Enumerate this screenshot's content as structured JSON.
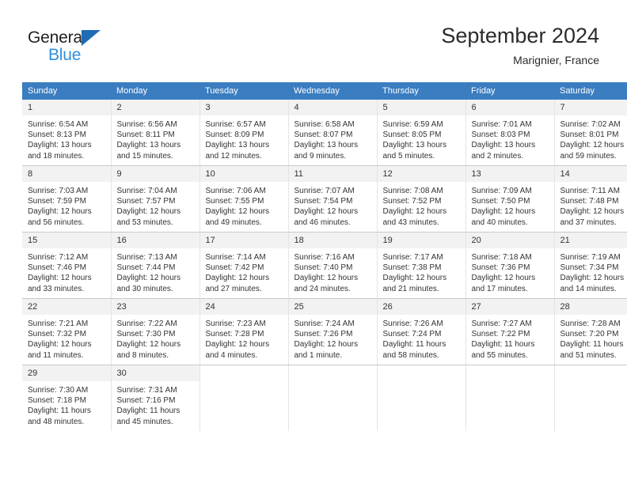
{
  "brand": {
    "line1": "General",
    "line2": "Blue",
    "triangle_color": "#1f6bb5",
    "line2_color": "#2f8fdd"
  },
  "header": {
    "title": "September 2024",
    "subtitle": "Marignier, France"
  },
  "theme": {
    "header_row_bg": "#3a7dc0",
    "header_row_text": "#ffffff",
    "daynum_bg": "#f2f2f2",
    "cell_text": "#333333",
    "grid_line": "#c8c8c8"
  },
  "calendar": {
    "weekday_headers": [
      "Sunday",
      "Monday",
      "Tuesday",
      "Wednesday",
      "Thursday",
      "Friday",
      "Saturday"
    ],
    "weeks": [
      [
        {
          "day": "1",
          "sunrise": "Sunrise: 6:54 AM",
          "sunset": "Sunset: 8:13 PM",
          "daylight_line1": "Daylight: 13 hours",
          "daylight_line2": "and 18 minutes."
        },
        {
          "day": "2",
          "sunrise": "Sunrise: 6:56 AM",
          "sunset": "Sunset: 8:11 PM",
          "daylight_line1": "Daylight: 13 hours",
          "daylight_line2": "and 15 minutes."
        },
        {
          "day": "3",
          "sunrise": "Sunrise: 6:57 AM",
          "sunset": "Sunset: 8:09 PM",
          "daylight_line1": "Daylight: 13 hours",
          "daylight_line2": "and 12 minutes."
        },
        {
          "day": "4",
          "sunrise": "Sunrise: 6:58 AM",
          "sunset": "Sunset: 8:07 PM",
          "daylight_line1": "Daylight: 13 hours",
          "daylight_line2": "and 9 minutes."
        },
        {
          "day": "5",
          "sunrise": "Sunrise: 6:59 AM",
          "sunset": "Sunset: 8:05 PM",
          "daylight_line1": "Daylight: 13 hours",
          "daylight_line2": "and 5 minutes."
        },
        {
          "day": "6",
          "sunrise": "Sunrise: 7:01 AM",
          "sunset": "Sunset: 8:03 PM",
          "daylight_line1": "Daylight: 13 hours",
          "daylight_line2": "and 2 minutes."
        },
        {
          "day": "7",
          "sunrise": "Sunrise: 7:02 AM",
          "sunset": "Sunset: 8:01 PM",
          "daylight_line1": "Daylight: 12 hours",
          "daylight_line2": "and 59 minutes."
        }
      ],
      [
        {
          "day": "8",
          "sunrise": "Sunrise: 7:03 AM",
          "sunset": "Sunset: 7:59 PM",
          "daylight_line1": "Daylight: 12 hours",
          "daylight_line2": "and 56 minutes."
        },
        {
          "day": "9",
          "sunrise": "Sunrise: 7:04 AM",
          "sunset": "Sunset: 7:57 PM",
          "daylight_line1": "Daylight: 12 hours",
          "daylight_line2": "and 53 minutes."
        },
        {
          "day": "10",
          "sunrise": "Sunrise: 7:06 AM",
          "sunset": "Sunset: 7:55 PM",
          "daylight_line1": "Daylight: 12 hours",
          "daylight_line2": "and 49 minutes."
        },
        {
          "day": "11",
          "sunrise": "Sunrise: 7:07 AM",
          "sunset": "Sunset: 7:54 PM",
          "daylight_line1": "Daylight: 12 hours",
          "daylight_line2": "and 46 minutes."
        },
        {
          "day": "12",
          "sunrise": "Sunrise: 7:08 AM",
          "sunset": "Sunset: 7:52 PM",
          "daylight_line1": "Daylight: 12 hours",
          "daylight_line2": "and 43 minutes."
        },
        {
          "day": "13",
          "sunrise": "Sunrise: 7:09 AM",
          "sunset": "Sunset: 7:50 PM",
          "daylight_line1": "Daylight: 12 hours",
          "daylight_line2": "and 40 minutes."
        },
        {
          "day": "14",
          "sunrise": "Sunrise: 7:11 AM",
          "sunset": "Sunset: 7:48 PM",
          "daylight_line1": "Daylight: 12 hours",
          "daylight_line2": "and 37 minutes."
        }
      ],
      [
        {
          "day": "15",
          "sunrise": "Sunrise: 7:12 AM",
          "sunset": "Sunset: 7:46 PM",
          "daylight_line1": "Daylight: 12 hours",
          "daylight_line2": "and 33 minutes."
        },
        {
          "day": "16",
          "sunrise": "Sunrise: 7:13 AM",
          "sunset": "Sunset: 7:44 PM",
          "daylight_line1": "Daylight: 12 hours",
          "daylight_line2": "and 30 minutes."
        },
        {
          "day": "17",
          "sunrise": "Sunrise: 7:14 AM",
          "sunset": "Sunset: 7:42 PM",
          "daylight_line1": "Daylight: 12 hours",
          "daylight_line2": "and 27 minutes."
        },
        {
          "day": "18",
          "sunrise": "Sunrise: 7:16 AM",
          "sunset": "Sunset: 7:40 PM",
          "daylight_line1": "Daylight: 12 hours",
          "daylight_line2": "and 24 minutes."
        },
        {
          "day": "19",
          "sunrise": "Sunrise: 7:17 AM",
          "sunset": "Sunset: 7:38 PM",
          "daylight_line1": "Daylight: 12 hours",
          "daylight_line2": "and 21 minutes."
        },
        {
          "day": "20",
          "sunrise": "Sunrise: 7:18 AM",
          "sunset": "Sunset: 7:36 PM",
          "daylight_line1": "Daylight: 12 hours",
          "daylight_line2": "and 17 minutes."
        },
        {
          "day": "21",
          "sunrise": "Sunrise: 7:19 AM",
          "sunset": "Sunset: 7:34 PM",
          "daylight_line1": "Daylight: 12 hours",
          "daylight_line2": "and 14 minutes."
        }
      ],
      [
        {
          "day": "22",
          "sunrise": "Sunrise: 7:21 AM",
          "sunset": "Sunset: 7:32 PM",
          "daylight_line1": "Daylight: 12 hours",
          "daylight_line2": "and 11 minutes."
        },
        {
          "day": "23",
          "sunrise": "Sunrise: 7:22 AM",
          "sunset": "Sunset: 7:30 PM",
          "daylight_line1": "Daylight: 12 hours",
          "daylight_line2": "and 8 minutes."
        },
        {
          "day": "24",
          "sunrise": "Sunrise: 7:23 AM",
          "sunset": "Sunset: 7:28 PM",
          "daylight_line1": "Daylight: 12 hours",
          "daylight_line2": "and 4 minutes."
        },
        {
          "day": "25",
          "sunrise": "Sunrise: 7:24 AM",
          "sunset": "Sunset: 7:26 PM",
          "daylight_line1": "Daylight: 12 hours",
          "daylight_line2": "and 1 minute."
        },
        {
          "day": "26",
          "sunrise": "Sunrise: 7:26 AM",
          "sunset": "Sunset: 7:24 PM",
          "daylight_line1": "Daylight: 11 hours",
          "daylight_line2": "and 58 minutes."
        },
        {
          "day": "27",
          "sunrise": "Sunrise: 7:27 AM",
          "sunset": "Sunset: 7:22 PM",
          "daylight_line1": "Daylight: 11 hours",
          "daylight_line2": "and 55 minutes."
        },
        {
          "day": "28",
          "sunrise": "Sunrise: 7:28 AM",
          "sunset": "Sunset: 7:20 PM",
          "daylight_line1": "Daylight: 11 hours",
          "daylight_line2": "and 51 minutes."
        }
      ],
      [
        {
          "day": "29",
          "sunrise": "Sunrise: 7:30 AM",
          "sunset": "Sunset: 7:18 PM",
          "daylight_line1": "Daylight: 11 hours",
          "daylight_line2": "and 48 minutes."
        },
        {
          "day": "30",
          "sunrise": "Sunrise: 7:31 AM",
          "sunset": "Sunset: 7:16 PM",
          "daylight_line1": "Daylight: 11 hours",
          "daylight_line2": "and 45 minutes."
        },
        {
          "day": "",
          "sunrise": "",
          "sunset": "",
          "daylight_line1": "",
          "daylight_line2": ""
        },
        {
          "day": "",
          "sunrise": "",
          "sunset": "",
          "daylight_line1": "",
          "daylight_line2": ""
        },
        {
          "day": "",
          "sunrise": "",
          "sunset": "",
          "daylight_line1": "",
          "daylight_line2": ""
        },
        {
          "day": "",
          "sunrise": "",
          "sunset": "",
          "daylight_line1": "",
          "daylight_line2": ""
        },
        {
          "day": "",
          "sunrise": "",
          "sunset": "",
          "daylight_line1": "",
          "daylight_line2": ""
        }
      ]
    ]
  }
}
